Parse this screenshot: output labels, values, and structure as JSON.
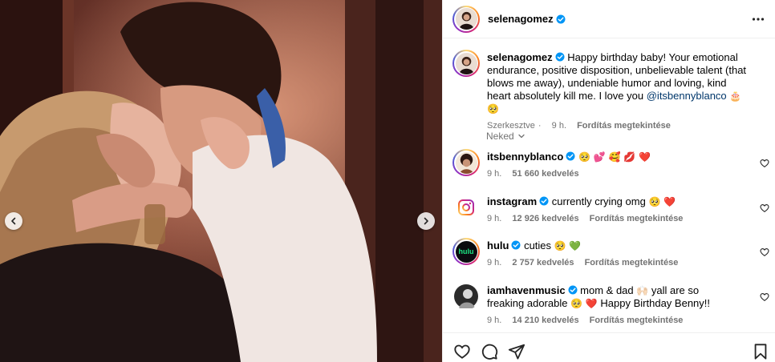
{
  "post": {
    "author": "selenagomez",
    "author_verified": true
  },
  "caption": {
    "username": "selenagomez",
    "text": "Happy birthday baby! Your emotional endurance, positive disposition, unbelievable talent (that blows me away), undeniable humor and loving, kind heart absolutely kill me. I love you",
    "mention": "@itsbennyblanco",
    "emojis": "🎂 🥺",
    "edited_label": "Szerkesztve",
    "time": "9 h.",
    "translate_label": "Fordítás megtekintése"
  },
  "filter": {
    "label": "Neked"
  },
  "comments": [
    {
      "username": "itsbennyblanco",
      "text": "",
      "emojis": "🥺 💕 🥰 💋 ❤️",
      "time": "9 h.",
      "likes": "51 660 kedvelés",
      "translate_label": ""
    },
    {
      "username": "instagram",
      "text": "currently crying omg",
      "emojis": "🥺 ❤️",
      "time": "9 h.",
      "likes": "12 926 kedvelés",
      "translate_label": "Fordítás megtekintése"
    },
    {
      "username": "hulu",
      "text": "cuties",
      "emojis": "🥺 💚",
      "time": "9 h.",
      "likes": "2 757 kedvelés",
      "translate_label": "Fordítás megtekintése"
    },
    {
      "username": "iamhavenmusic",
      "text_a": "mom & dad",
      "emoji_mid": "🙌🏻",
      "text_b": "yall are so freaking adorable",
      "emoji_end": "🥺 ❤️",
      "text_c": "Happy Birthday Benny!!",
      "time": "9 h.",
      "likes": "14 210 kedvelés",
      "translate_label": "Fordítás megtekintése"
    }
  ],
  "hulu_logo_text": "hulu",
  "icons": {
    "more": "more-options-icon",
    "verified": "verified-badge-icon",
    "heart": "heart-icon",
    "comment": "comment-icon",
    "share": "share-icon",
    "save": "bookmark-icon",
    "prev": "chevron-left-icon",
    "next": "chevron-right-icon"
  },
  "colors": {
    "verified": "#0095f6",
    "mention": "#00376b",
    "muted": "#737373",
    "instagram_gradient": [
      "#feda75",
      "#fa7e1e",
      "#d62976",
      "#962fbf",
      "#4f5bd5"
    ],
    "hulu_green": "#1ce783"
  }
}
